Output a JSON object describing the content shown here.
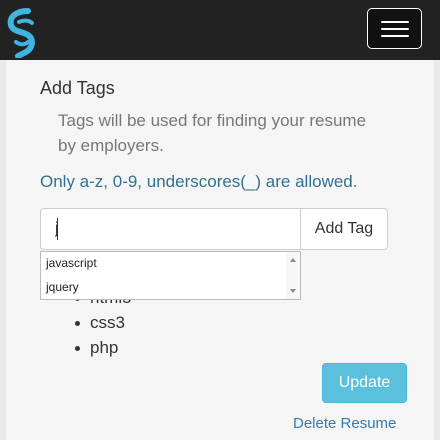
{
  "navbar": {
    "logo_icon": "logo-icon",
    "menu_icon": "hamburger-menu-icon",
    "colors": {
      "background": "#222222",
      "logo": "#3fb4e0"
    }
  },
  "tags_section": {
    "heading": "Add Tags",
    "help_text": "Tags will be used for finding your resume by employers.",
    "warning": "Only a-z, 0-9, underscores(_) are allowed.",
    "input_value": "j",
    "add_button": "Add Tag",
    "autocomplete_options": [
      "javascript",
      "jquery"
    ],
    "tags": [
      "html5",
      "css3",
      "php"
    ]
  },
  "actions": {
    "update": "Update",
    "delete": "Delete Resume"
  },
  "colors": {
    "info": "#5bc0de",
    "link": "#337ab7",
    "warning_text": "#31708f"
  }
}
